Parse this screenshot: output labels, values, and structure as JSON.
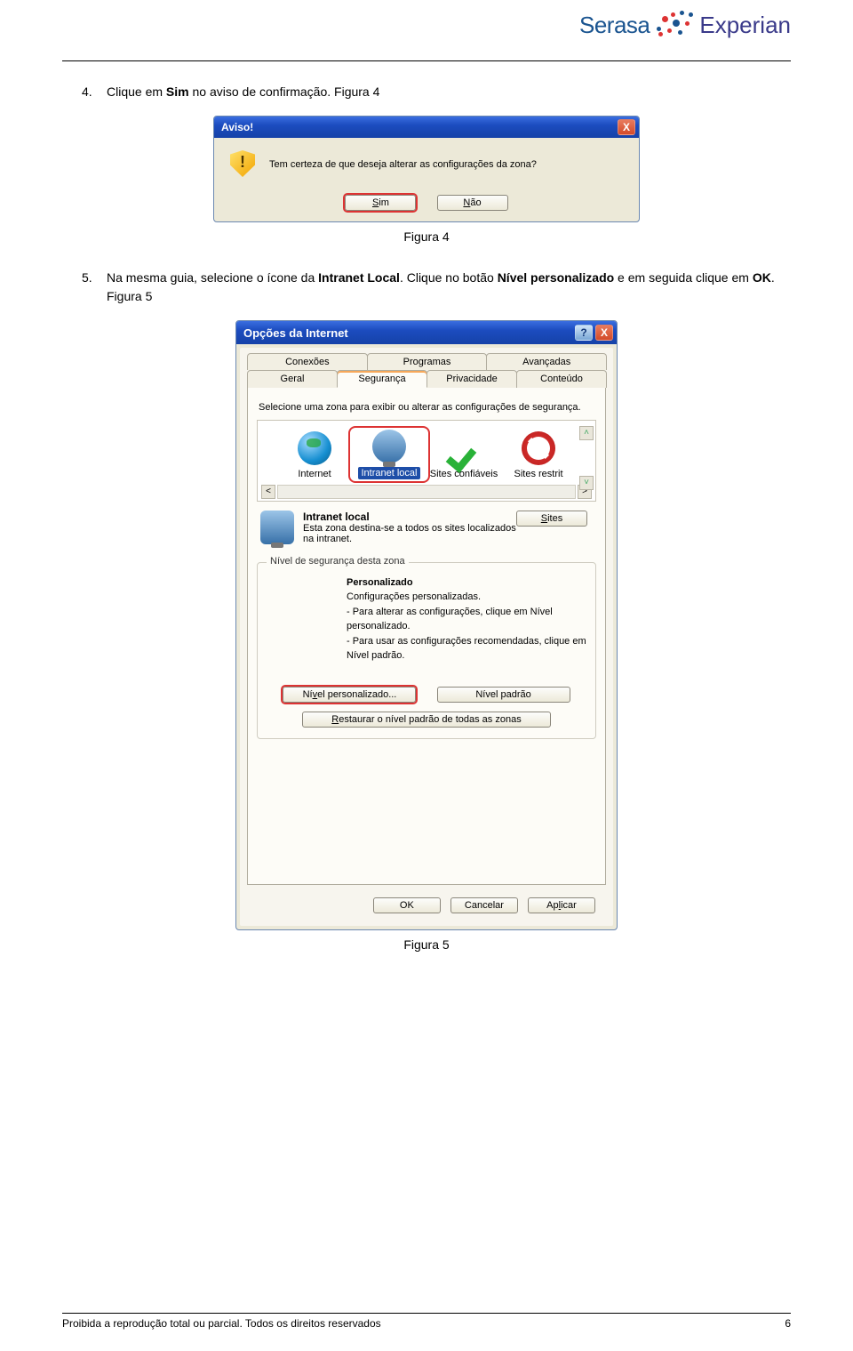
{
  "header": {
    "brand_left": "Serasa",
    "brand_right": "Experian"
  },
  "step4": {
    "num": "4.",
    "text_a": "Clique em ",
    "bold_a": "Sim",
    "text_b": " no aviso de confirmação. Figura 4",
    "caption": "Figura 4"
  },
  "aviso": {
    "title": "Aviso!",
    "close": "X",
    "message": "Tem certeza de que deseja alterar as configurações da zona?",
    "sim_underline": "S",
    "sim_rest": "im",
    "nao_underline": "N",
    "nao_rest": "ão"
  },
  "step5": {
    "num": "5.",
    "text_a": "Na mesma guia, selecione o ícone da ",
    "bold_a": "Intranet Local",
    "text_b": ". Clique no botão ",
    "bold_b": "Nível personalizado",
    "text_c": " e em seguida clique em ",
    "bold_c": "OK",
    "text_d": ". Figura 5",
    "caption": "Figura 5"
  },
  "opts": {
    "title": "Opções da Internet",
    "help": "?",
    "close": "X",
    "tabs_top": [
      "Conexões",
      "Programas",
      "Avançadas"
    ],
    "tabs_bottom": [
      "Geral",
      "Segurança",
      "Privacidade",
      "Conteúdo"
    ],
    "active_tab": "Segurança",
    "zone_instruction": "Selecione uma zona para exibir ou alterar as configurações de segurança.",
    "zones": [
      {
        "label": "Internet"
      },
      {
        "label": "Intranet local"
      },
      {
        "label": "Sites confiáveis"
      },
      {
        "label": "Sites restrit"
      }
    ],
    "selected_zone_title": "Intranet local",
    "selected_zone_desc": "Esta zona destina-se a todos os sites localizados na intranet.",
    "sites_underline": "S",
    "sites_rest": "ites",
    "fieldset_legend": "Nível de segurança desta zona",
    "pers_title": "Personalizado",
    "pers_l1": "Configurações personalizadas.",
    "pers_l2": "- Para alterar as configurações, clique em Nível personalizado.",
    "pers_l3": "- Para usar as configurações recomendadas, clique em Nível padrão.",
    "nivel_pers_underline": "v",
    "nivel_pers_before": "Ní",
    "nivel_pers_after": "el personalizado...",
    "nivel_padrao": "Nível padrão",
    "restaurar_underline": "R",
    "restaurar_rest": "estaurar o nível padrão de todas as zonas",
    "ok": "OK",
    "cancelar": "Cancelar",
    "aplicar_underline": "A",
    "aplicar_before": "Ap",
    "aplicar_underlined": "l",
    "aplicar_after": "icar"
  },
  "footer": {
    "text": "Proibida a reprodução total ou parcial. Todos os direitos reservados",
    "page": "6"
  }
}
